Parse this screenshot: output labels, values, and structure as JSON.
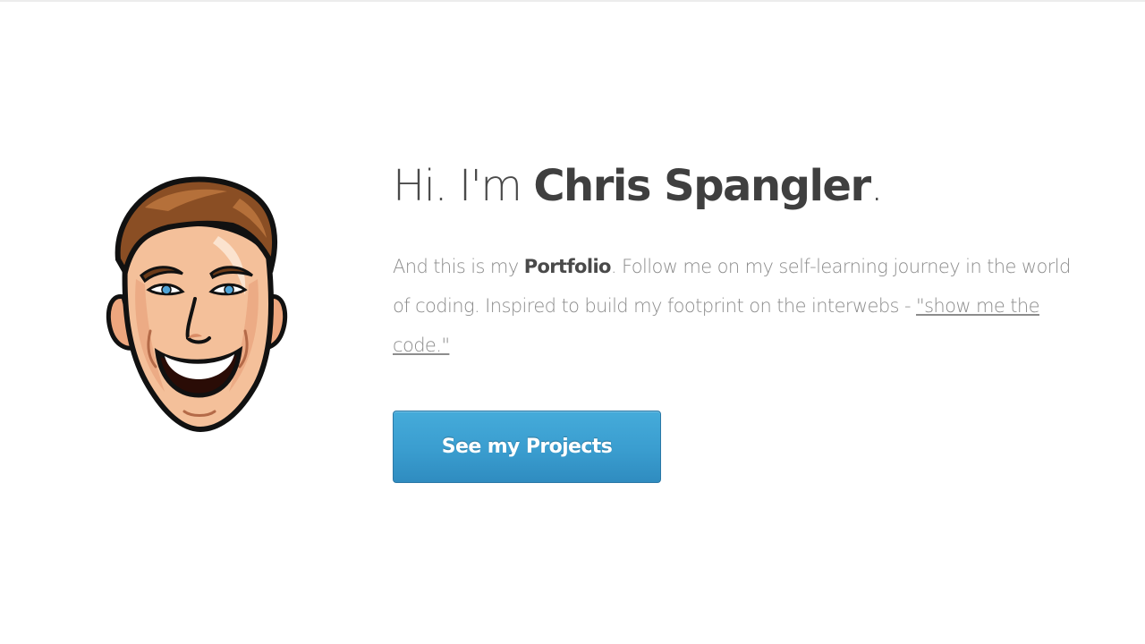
{
  "hero": {
    "greeting": "Hi. I'm ",
    "name": "Chris Spangler",
    "greeting_end": ".",
    "intro_1": "And this is my ",
    "intro_strong": "Portfolio",
    "intro_2": ". Follow me on my self-learning journey in the world of coding. Inspired to build my footprint on the interwebs - ",
    "intro_link": "\"show me the code.\"",
    "cta_label": "See my Projects"
  },
  "colors": {
    "button": "#3a9dcf",
    "heading": "#3f3f3f",
    "body_text": "#8c8c8c"
  },
  "icons": {
    "avatar": "cartoon-portrait-icon"
  }
}
